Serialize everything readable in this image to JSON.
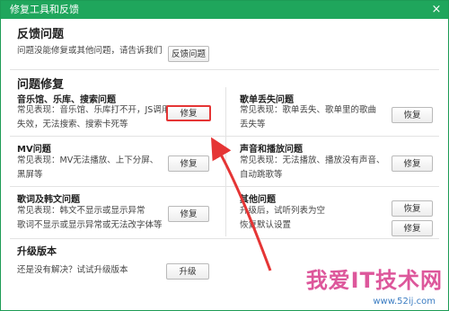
{
  "window": {
    "title": "修复工具和反馈",
    "close_glyph": "×"
  },
  "feedback": {
    "heading": "反馈问题",
    "text": "问题没能修复或其他问题，请告诉我们",
    "button": "反馈问题"
  },
  "repair": {
    "heading": "问题修复",
    "items": [
      {
        "title": "音乐馆、乐库、搜索问题",
        "line1": "常见表现：音乐馆、乐库打不开，JS调用",
        "line2": "失效，无法搜索、搜索卡死等",
        "button": "修复"
      },
      {
        "title": "歌单丢失问题",
        "line1": "常见表现：歌单丢失、歌单里的歌曲",
        "line2": "丢失等",
        "button": "恢复"
      },
      {
        "title": "MV问题",
        "line1": "常见表现：MV无法播放、上下分屏、",
        "line2": "黑屏等",
        "button": "修复"
      },
      {
        "title": "声音和播放问题",
        "line1": "常见表现：无法播放、播放没有声音、",
        "line2": "自动跳歌等",
        "button": "修复"
      },
      {
        "title": "歌词及韩文问题",
        "line1": "常见表现：韩文不显示或显示异常",
        "line2": "歌词不显示或显示异常或无法改字体等",
        "button": "修复"
      },
      {
        "title": "其他问题",
        "line1": "升级后，试听列表为空",
        "line2": "恢复默认设置",
        "button1": "恢复",
        "button2": "修复"
      }
    ]
  },
  "upgrade": {
    "heading": "升级版本",
    "text": "还是没有解决？试试升级版本",
    "button": "升级"
  },
  "watermark": {
    "main": "我爱IT技术网",
    "sub": "www.52ij.com"
  },
  "annotation": {
    "color": "#e53535",
    "target": "highlight on first 修复 button"
  }
}
